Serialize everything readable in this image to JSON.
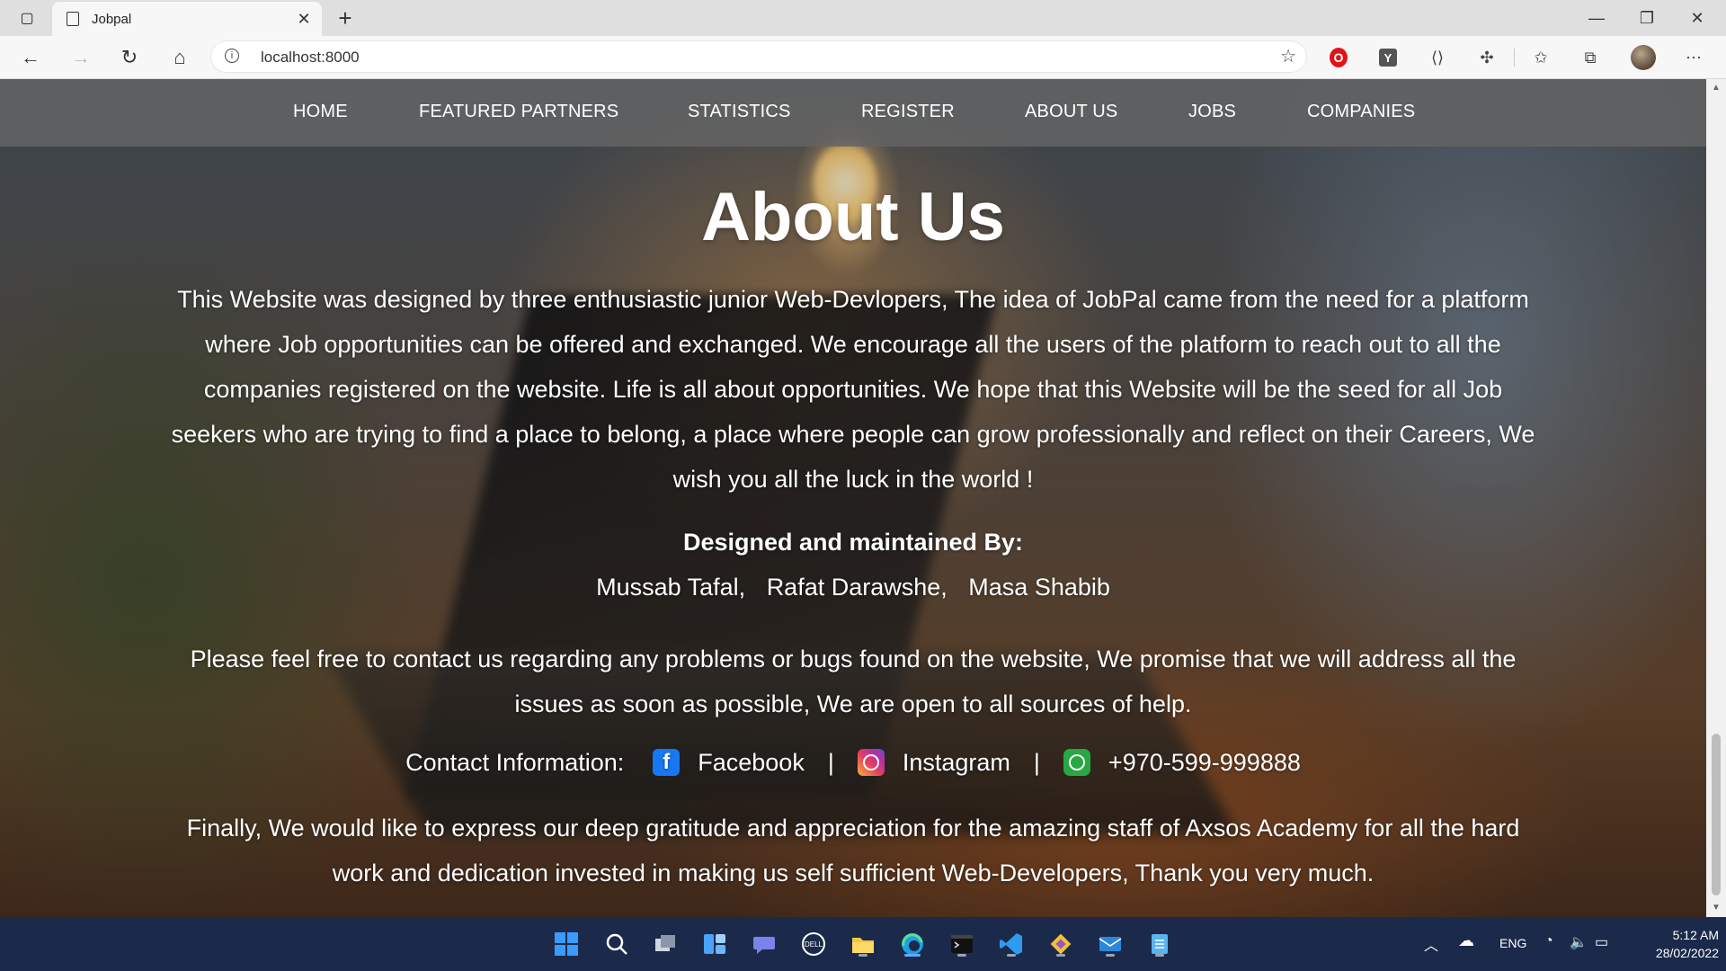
{
  "browser": {
    "tab_title": "Jobpal",
    "url": "localhost:8000"
  },
  "site_nav": {
    "items": [
      "HOME",
      "FEATURED PARTNERS",
      "STATISTICS",
      "REGISTER",
      "ABOUT US",
      "JOBS",
      "COMPANIES"
    ]
  },
  "about": {
    "title": "About Us",
    "intro": "This Website was designed by three enthusiastic junior Web-Devlopers, The idea of JobPal came from the need for a platform where Job opportunities can be offered and exchanged. We encourage all the users of the platform to reach out to all the companies registered on the website. Life is all about opportunities. We hope that this Website will be the seed for all Job seekers who are trying to find a place to belong, a place where people can grow professionally and reflect on their Careers, We wish you all the luck in the world !",
    "designed_heading": "Designed and maintained By:",
    "designers": [
      "Mussab Tafal,",
      "Rafat Darawshe,",
      "Masa Shabib"
    ],
    "contact_paragraph": "Please feel free to contact us regarding any problems or bugs found on the website, We promise that we will address all the issues as soon as possible, We are open to all sources of help.",
    "contact_label": "Contact Information:",
    "facebook": "Facebook",
    "instagram": "Instagram",
    "separator": "|",
    "phone": "+970-599-999888",
    "closing": "Finally, We would like to express our deep gratitude and appreciation for the amazing staff of Axsos Academy for all the hard work and dedication invested in making us self sufficient Web-Developers, Thank you very much."
  },
  "taskbar": {
    "language": "ENG",
    "time": "5:12 AM",
    "date": "28/02/2022"
  },
  "icons": {
    "facebook_color": "#1877f2",
    "whatsapp_color": "#27a844",
    "accent": "#62a8ff"
  }
}
